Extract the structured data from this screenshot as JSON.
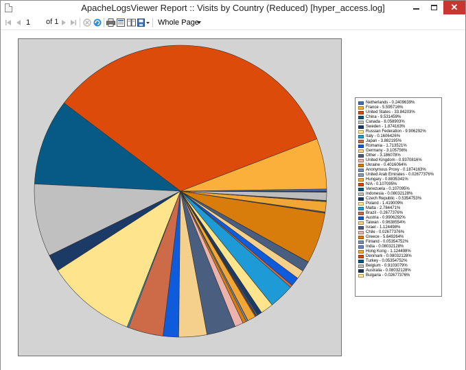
{
  "window": {
    "title": "ApacheLogsViewer Report :: Visits by Country (Reduced) [hyper_access.log]",
    "close_glyph": "✕"
  },
  "toolbar": {
    "page_value": "1",
    "page_of_label": "of 1",
    "zoom_value": "Whole Page",
    "icons": [
      "first-page-icon",
      "previous-page-icon",
      "next-page-icon",
      "last-page-icon",
      "stop-icon",
      "refresh-icon",
      "print-icon",
      "print-layout-icon",
      "page-setup-icon",
      "export-icon"
    ]
  },
  "colors": {
    "chart_background": "#d3d3d3",
    "close_button": "#c7372f"
  },
  "chart_data": {
    "type": "pie",
    "series": [
      {
        "name": "Netherlands - 0.2409639%",
        "value": 0.2409639,
        "color": "#4472c4"
      },
      {
        "name": "France - 5.595716%",
        "value": 5.595716,
        "color": "#fbb03b"
      },
      {
        "name": "United States - 33.84203%",
        "value": 33.84203,
        "color": "#dc4b0a"
      },
      {
        "name": "China - 9.531459%",
        "value": 9.531459,
        "color": "#075a86"
      },
      {
        "name": "Canada - 8.058903%",
        "value": 8.058903,
        "color": "#c0c0c0"
      },
      {
        "name": "Sweden - 1.874163%",
        "value": 1.874163,
        "color": "#1b3a66"
      },
      {
        "name": "Russian Federation - 9.906292%",
        "value": 9.906292,
        "color": "#fee48c"
      },
      {
        "name": "Italy - 0.1606426%",
        "value": 0.1606426,
        "color": "#1e9ad6"
      },
      {
        "name": "Japan - 3.882195%",
        "value": 3.882195,
        "color": "#cd6a48"
      },
      {
        "name": "Romania - 1.713521%",
        "value": 1.713521,
        "color": "#0e5bdc"
      },
      {
        "name": "Germany - 3.105756%",
        "value": 3.105756,
        "color": "#f5d08d"
      },
      {
        "name": "Other - 3.186078%",
        "value": 3.186078,
        "color": "#4a5e80"
      },
      {
        "name": "United Kingdom - 0.9370816%",
        "value": 0.9370816,
        "color": "#ebb3ac"
      },
      {
        "name": "Ukraine - 0.4016064%",
        "value": 0.4016064,
        "color": "#d87c0c"
      },
      {
        "name": "Anonymous Proxy - 0.1874163%",
        "value": 0.1874163,
        "color": "#7b8fb5"
      },
      {
        "name": "United Arab Emirates - 0.02677376%",
        "value": 0.02677376,
        "color": "#8a9ab8"
      },
      {
        "name": "Hungary - 0.8835341%",
        "value": 0.8835341,
        "color": "#f2a734"
      },
      {
        "name": "N/A - 0.107095%",
        "value": 0.107095,
        "color": "#d9480b"
      },
      {
        "name": "Venezuela - 0.107095%",
        "value": 0.107095,
        "color": "#075a86"
      },
      {
        "name": "Indonesia - 0.08032128%",
        "value": 0.08032128,
        "color": "#bdbdbd"
      },
      {
        "name": "Czech Republic - 0.5354753%",
        "value": 0.5354753,
        "color": "#1b3a66"
      },
      {
        "name": "Poland - 1.419009%",
        "value": 1.419009,
        "color": "#fee48c"
      },
      {
        "name": "Malta - 2.784471%",
        "value": 2.784471,
        "color": "#1e9ad6"
      },
      {
        "name": "Brazil - 0.2677376%",
        "value": 0.2677376,
        "color": "#cd6a48"
      },
      {
        "name": "Austria - 0.9906292%",
        "value": 0.9906292,
        "color": "#0e5bdc"
      },
      {
        "name": "Taiwan - 0.9638554%",
        "value": 0.9638554,
        "color": "#f5d08d"
      },
      {
        "name": "Israel - 1.124498%",
        "value": 1.124498,
        "color": "#4a5e80"
      },
      {
        "name": "Chile - 0.02677376%",
        "value": 0.02677376,
        "color": "#ebb3ac"
      },
      {
        "name": "Greece - 5.649264%",
        "value": 5.649264,
        "color": "#d87c0c"
      },
      {
        "name": "Finland - 0.05354752%",
        "value": 0.05354752,
        "color": "#7b8fb5"
      },
      {
        "name": "India - 0.08032128%",
        "value": 0.08032128,
        "color": "#6b86c2"
      },
      {
        "name": "Hong Kong - 1.124498%",
        "value": 1.124498,
        "color": "#f2a734"
      },
      {
        "name": "Denmark - 0.08032128%",
        "value": 0.08032128,
        "color": "#d9480b"
      },
      {
        "name": "Turkey - 0.05354752%",
        "value": 0.05354752,
        "color": "#075a86"
      },
      {
        "name": "Belgium - 0.9103079%",
        "value": 0.9103079,
        "color": "#bdbdbd"
      },
      {
        "name": "Australia - 0.08032128%",
        "value": 0.08032128,
        "color": "#1b3a66"
      },
      {
        "name": "Bulgaria - 0.02677376%",
        "value": 0.02677376,
        "color": "#fee48c"
      }
    ],
    "start_angle_deg": 0,
    "direction": "counterclockwise",
    "legend_placement": "right"
  }
}
